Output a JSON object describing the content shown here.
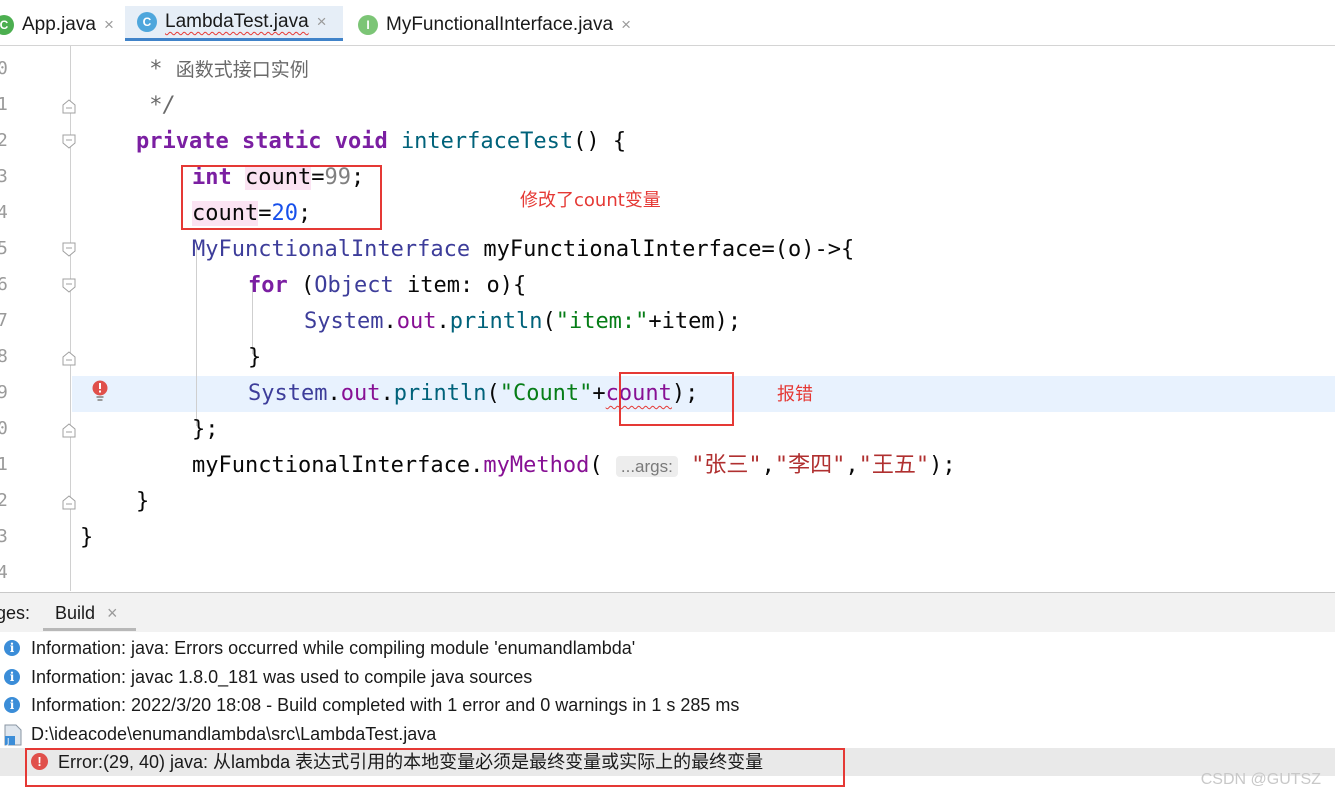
{
  "tabs": [
    {
      "label": "App.java",
      "icon": "java-class-icon"
    },
    {
      "label": "LambdaTest.java",
      "icon": "java-class-icon",
      "active": true
    },
    {
      "label": "MyFunctionalInterface.java",
      "icon": "interface-icon"
    }
  ],
  "tab_close": "×",
  "icon_letters": {
    "class": "C",
    "interface": "I"
  },
  "line_numbers": [
    "0",
    "1",
    "2",
    "3",
    "4",
    "5",
    "6",
    "7",
    "8",
    "9",
    "0",
    "1",
    "2",
    "3",
    "4"
  ],
  "code": {
    "comment_star": " * ",
    "comment_text": "函数式接口实例",
    "comment_end": " */",
    "l_private": "private",
    "l_static": "static",
    "l_void": "void",
    "l_method": "interfaceTest",
    "l_method_tail": "() {",
    "l_int": "int",
    "l_count": "count",
    "l_eq": "=",
    "l_99": "99",
    "l_semi": ";",
    "l_20": "20",
    "l_iface": "MyFunctionalInterface",
    "l_var_decl": " myFunctionalInterface=(o)->{",
    "l_for": "for",
    "l_for_open": " (",
    "l_object": "Object",
    "l_for_rest": " item: o){",
    "l_system": "System",
    "l_dot": ".",
    "l_out": "out",
    "l_println": "println",
    "l_paren_open": "(",
    "l_item_str": "\"item:\"",
    "l_item_rest": "+item);",
    "l_close_brace": "}",
    "l_count_str": "\"Count\"",
    "l_plus": "+",
    "l_count_err": "count",
    "l_err_tail": ");",
    "l_lambda_end": "};",
    "l_var": "myFunctionalInterface",
    "l_mymethod": "myMethod",
    "l_hint": "...args:",
    "l_s1": "\"张三\"",
    "l_comma": ",",
    "l_s2": "\"李四\"",
    "l_s3": "\"王五\"",
    "l_call_end": ");"
  },
  "annotations": {
    "modified": "修改了count变量",
    "error": "报错"
  },
  "panel": {
    "tab_prefix": "ges:",
    "tab_build": "Build",
    "tab_close": "×"
  },
  "messages": [
    {
      "type": "info",
      "text": "Information: java: Errors occurred while compiling module 'enumandlambda'"
    },
    {
      "type": "info",
      "text": "Information: javac 1.8.0_181 was used to compile java sources"
    },
    {
      "type": "info",
      "text": "Information: 2022/3/20 18:08 - Build completed with 1 error and 0 warnings in 1 s 285 ms"
    },
    {
      "type": "file",
      "text": "D:\\ideacode\\enumandlambda\\src\\LambdaTest.java"
    },
    {
      "type": "error",
      "text": "Error:(29, 40)  java: 从lambda 表达式引用的本地变量必须是最终变量或实际上的最终变量"
    }
  ],
  "watermark": "CSDN @GUTSZ",
  "colors": {
    "error_box": "#e53935",
    "accent": "#4083c9",
    "highlight_line": "#e8f2fe"
  }
}
